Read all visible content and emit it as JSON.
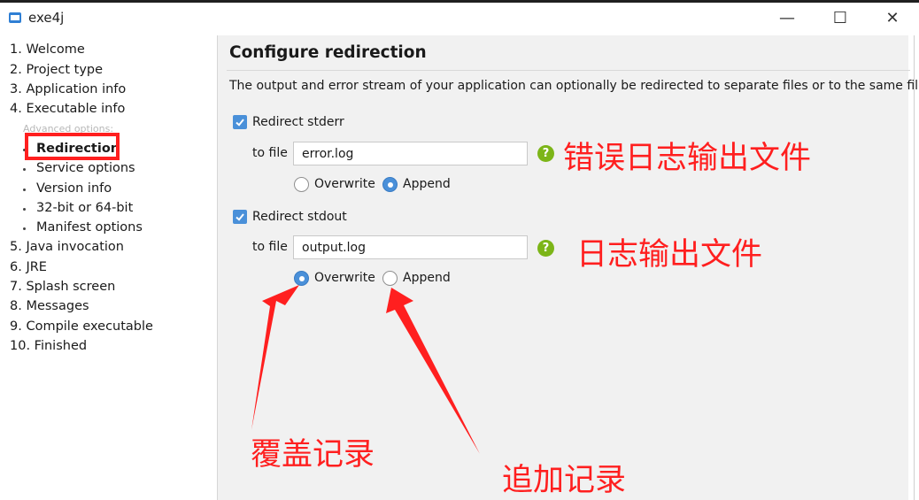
{
  "window": {
    "title": "exe4j",
    "minimize_glyph": "—",
    "maximize_glyph": "☐",
    "close_glyph": "✕"
  },
  "sidebar": {
    "items": [
      {
        "label": "1. Welcome"
      },
      {
        "label": "2. Project type"
      },
      {
        "label": "3. Application info"
      },
      {
        "label": "4. Executable info"
      }
    ],
    "advanced_label": "Advanced options:",
    "sub_items": [
      {
        "label": "Redirection",
        "active": true
      },
      {
        "label": "Service options"
      },
      {
        "label": "Version info"
      },
      {
        "label": "32-bit or 64-bit"
      },
      {
        "label": "Manifest options"
      }
    ],
    "items_after": [
      {
        "label": "5. Java invocation"
      },
      {
        "label": "6. JRE"
      },
      {
        "label": "7. Splash screen"
      },
      {
        "label": "8. Messages"
      },
      {
        "label": "9. Compile executable"
      },
      {
        "label": "10. Finished"
      }
    ]
  },
  "main": {
    "title": "Configure redirection",
    "description": "The output and error stream of your application can optionally be redirected to separate files or to the same file.",
    "stderr": {
      "checkbox_label": "Redirect stderr",
      "checked": true,
      "to_file_label": "to file",
      "file_value": "error.log",
      "help_glyph": "?",
      "overwrite_label": "Overwrite",
      "append_label": "Append",
      "selected": "Append"
    },
    "stdout": {
      "checkbox_label": "Redirect stdout",
      "checked": true,
      "to_file_label": "to file",
      "file_value": "output.log",
      "help_glyph": "?",
      "overwrite_label": "Overwrite",
      "append_label": "Append",
      "selected": "Overwrite"
    }
  },
  "annotations": {
    "error_log_note": "错误日志输出文件",
    "output_log_note": "日志输出文件",
    "overwrite_note": "覆盖记录",
    "append_note": "追加记录",
    "color": "#ff1f1f"
  },
  "colors": {
    "accent": "#4a90d9",
    "help": "#7cb518",
    "annotation": "#ff1f1f"
  }
}
